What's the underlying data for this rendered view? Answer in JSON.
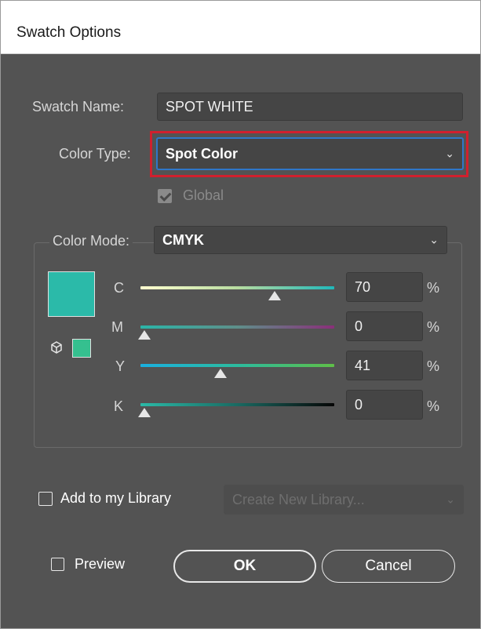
{
  "dialog": {
    "title": "Swatch Options",
    "swatch_name_label": "Swatch Name:",
    "swatch_name_value": "SPOT WHITE",
    "color_type_label": "Color Type:",
    "color_type_value": "Spot Color",
    "global_label": "Global",
    "global_checked": true,
    "color_mode_label": "Color Mode:",
    "color_mode_value": "CMYK",
    "swatch_color": "#2bbaa9",
    "out_of_gamut_color": "#35c08f",
    "channels": [
      {
        "label": "C",
        "value": "70",
        "unit": "%",
        "level": 0.7
      },
      {
        "label": "M",
        "value": "0",
        "unit": "%",
        "level": 0.0
      },
      {
        "label": "Y",
        "value": "41",
        "unit": "%",
        "level": 0.41
      },
      {
        "label": "K",
        "value": "0",
        "unit": "%",
        "level": 0.0
      }
    ],
    "add_library_label": "Add to my Library",
    "library_dropdown_value": "Create New Library...",
    "preview_label": "Preview",
    "ok_label": "OK",
    "cancel_label": "Cancel"
  },
  "colors": {
    "background": "#535353",
    "highlight": "#d0202e",
    "focus": "#2f77c9"
  }
}
